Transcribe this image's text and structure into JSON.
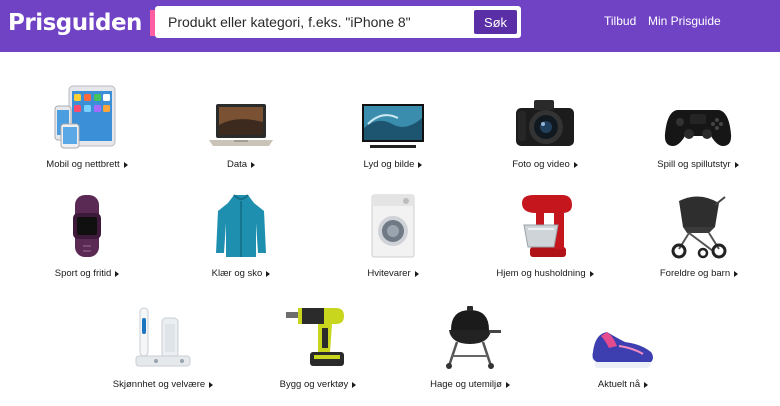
{
  "header": {
    "logo_text": "Prisguiden",
    "search_placeholder": "Produkt eller kategori, f.eks. \"iPhone 8\"",
    "search_button": "Søk",
    "nav": {
      "deals": "Tilbud",
      "my_account": "Min Prisguide"
    },
    "colors": {
      "bar": "#7043c4",
      "button": "#5a2ea6",
      "logo_accent": "#ff5fa2"
    }
  },
  "categories": [
    {
      "label": "Mobil og nettbrett",
      "icon": "tablet-phone-icon"
    },
    {
      "label": "Data",
      "icon": "laptop-icon"
    },
    {
      "label": "Lyd og bilde",
      "icon": "tv-icon"
    },
    {
      "label": "Foto og video",
      "icon": "camera-icon"
    },
    {
      "label": "Spill og spillutstyr",
      "icon": "gamepad-icon"
    },
    {
      "label": "Sport og fritid",
      "icon": "fitness-tracker-icon"
    },
    {
      "label": "Klær og sko",
      "icon": "jacket-icon"
    },
    {
      "label": "Hvitevarer",
      "icon": "washing-machine-icon"
    },
    {
      "label": "Hjem og husholdning",
      "icon": "stand-mixer-icon"
    },
    {
      "label": "Foreldre og barn",
      "icon": "stroller-icon"
    },
    {
      "label": "Skjønnhet og velvære",
      "icon": "toothbrush-icon"
    },
    {
      "label": "Bygg og verktøy",
      "icon": "drill-icon"
    },
    {
      "label": "Hage og utemiljø",
      "icon": "grill-icon"
    },
    {
      "label": "Aktuelt nå",
      "icon": "sneaker-icon"
    }
  ]
}
